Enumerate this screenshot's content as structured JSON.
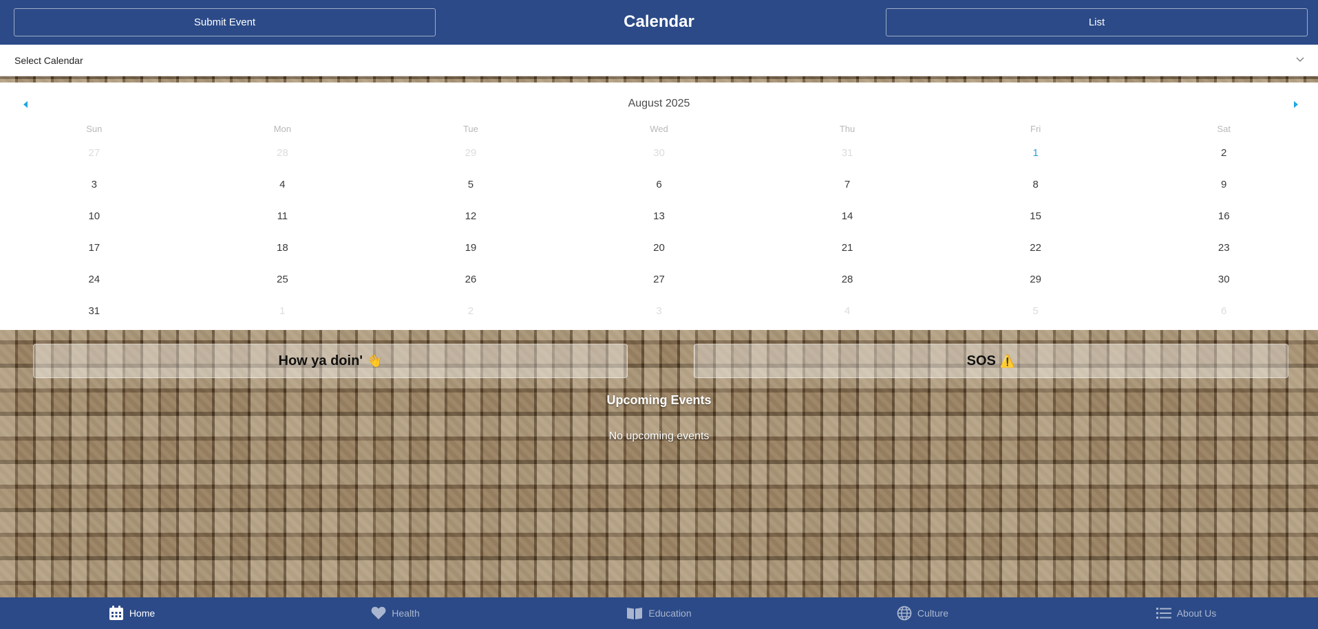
{
  "header": {
    "submit_label": "Submit Event",
    "title": "Calendar",
    "list_label": "List"
  },
  "select": {
    "label": "Select Calendar"
  },
  "calendar": {
    "month_label": "August 2025",
    "weekdays": [
      "Sun",
      "Mon",
      "Tue",
      "Wed",
      "Thu",
      "Fri",
      "Sat"
    ],
    "weeks": [
      [
        {
          "d": "27",
          "other": true
        },
        {
          "d": "28",
          "other": true
        },
        {
          "d": "29",
          "other": true
        },
        {
          "d": "30",
          "other": true
        },
        {
          "d": "31",
          "other": true
        },
        {
          "d": "1",
          "today": true
        },
        {
          "d": "2"
        }
      ],
      [
        {
          "d": "3"
        },
        {
          "d": "4"
        },
        {
          "d": "5"
        },
        {
          "d": "6"
        },
        {
          "d": "7"
        },
        {
          "d": "8"
        },
        {
          "d": "9"
        }
      ],
      [
        {
          "d": "10"
        },
        {
          "d": "11"
        },
        {
          "d": "12"
        },
        {
          "d": "13"
        },
        {
          "d": "14"
        },
        {
          "d": "15"
        },
        {
          "d": "16"
        }
      ],
      [
        {
          "d": "17"
        },
        {
          "d": "18"
        },
        {
          "d": "19"
        },
        {
          "d": "20"
        },
        {
          "d": "21"
        },
        {
          "d": "22"
        },
        {
          "d": "23"
        }
      ],
      [
        {
          "d": "24"
        },
        {
          "d": "25"
        },
        {
          "d": "26"
        },
        {
          "d": "27"
        },
        {
          "d": "28"
        },
        {
          "d": "29"
        },
        {
          "d": "30"
        }
      ],
      [
        {
          "d": "31"
        },
        {
          "d": "1",
          "other": true
        },
        {
          "d": "2",
          "other": true
        },
        {
          "d": "3",
          "other": true
        },
        {
          "d": "4",
          "other": true
        },
        {
          "d": "5",
          "other": true
        },
        {
          "d": "6",
          "other": true
        }
      ]
    ]
  },
  "mood": {
    "how_label": "How ya doin'",
    "how_emoji": "👋",
    "sos_label": "SOS",
    "sos_emoji": "⚠️"
  },
  "events": {
    "title": "Upcoming Events",
    "empty": "No upcoming events"
  },
  "nav": {
    "items": [
      {
        "label": "Home",
        "icon": "calendar-icon",
        "active": true
      },
      {
        "label": "Health",
        "icon": "heart-icon"
      },
      {
        "label": "Education",
        "icon": "book-icon"
      },
      {
        "label": "Culture",
        "icon": "globe-icon"
      },
      {
        "label": "About Us",
        "icon": "list-icon"
      }
    ]
  },
  "colors": {
    "primary": "#2c4a87",
    "today": "#2a9fd8",
    "nav_arrow": "#1ea7e0"
  }
}
